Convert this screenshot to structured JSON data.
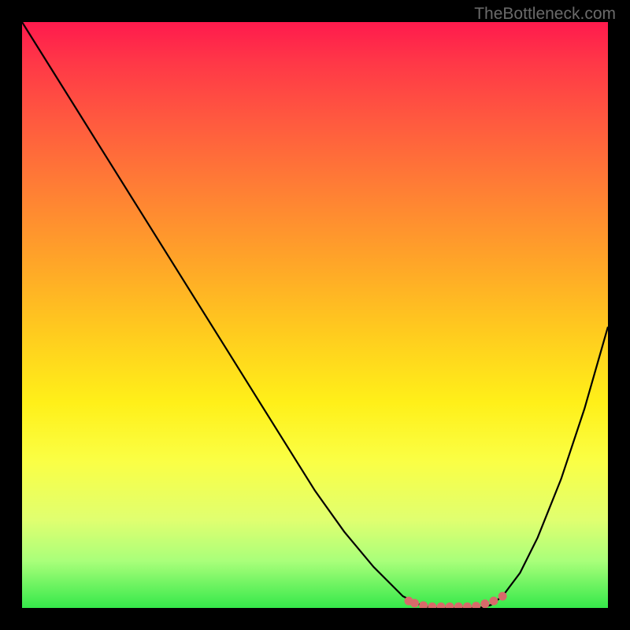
{
  "watermark": "TheBottleneck.com",
  "chart_data": {
    "type": "line",
    "title": "",
    "xlabel": "",
    "ylabel": "",
    "xlim": [
      0,
      100
    ],
    "ylim": [
      0,
      100
    ],
    "series": [
      {
        "name": "bottleneck-curve",
        "x": [
          0,
          5,
          10,
          15,
          20,
          25,
          30,
          35,
          40,
          45,
          50,
          55,
          60,
          65,
          68,
          70,
          72,
          75,
          78,
          80,
          82,
          85,
          88,
          92,
          96,
          100
        ],
        "y": [
          100,
          92,
          84,
          76,
          68,
          60,
          52,
          44,
          36,
          28,
          20,
          13,
          7,
          2,
          0.5,
          0,
          0,
          0,
          0,
          0.5,
          2,
          6,
          12,
          22,
          34,
          48
        ]
      }
    ],
    "markers": {
      "name": "optimal-zone-dots",
      "color": "#d86a6a",
      "x": [
        66,
        67,
        68.5,
        70,
        71.5,
        73,
        74.5,
        76,
        77.5,
        79,
        80.5,
        82
      ],
      "y": [
        1.2,
        0.8,
        0.4,
        0.2,
        0.2,
        0.2,
        0.2,
        0.2,
        0.3,
        0.7,
        1.2,
        2.0
      ]
    }
  }
}
